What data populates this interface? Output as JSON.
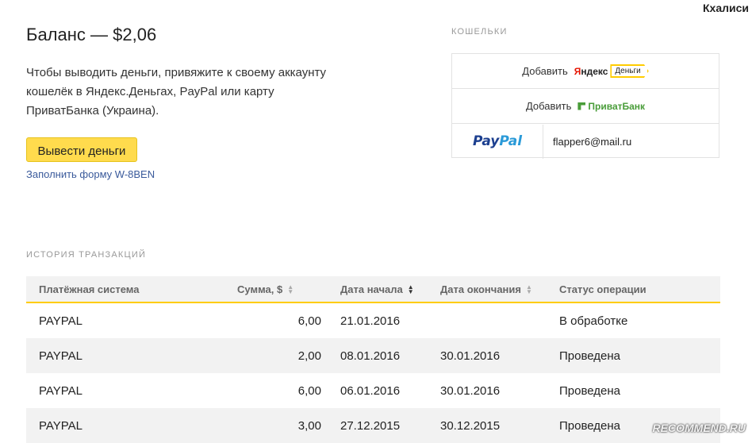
{
  "header": {
    "user_name": "Кхалиси"
  },
  "balance": {
    "title": "Баланс — $2,06"
  },
  "info": {
    "text": "Чтобы выводить деньги, привяжите к своему аккаунту кошелёк в Яндекс.Деньгах, PayPal или карту ПриватБанка (Украина)."
  },
  "actions": {
    "withdraw_label": "Вывести деньги",
    "w8_link": "Заполнить форму W-8BEN"
  },
  "wallets": {
    "section_label": "КОШЕЛЬКИ",
    "rows": [
      {
        "add_label": "Добавить",
        "logo_part1": "Яндекс",
        "logo_part2": "Деньги"
      },
      {
        "add_label": "Добавить",
        "logo_text": "ПриватБанк"
      },
      {
        "logo_pay": "Pay",
        "logo_pal": "Pal",
        "email": "flapper6@mail.ru"
      }
    ],
    "colors": {
      "yandex_red": "#e61400",
      "yandex_yellow": "#ffcc00",
      "privat_green": "#4a9d3a",
      "paypal_dark": "#1c3f8f",
      "paypal_light": "#2a9ad8"
    }
  },
  "transactions": {
    "section_label": "ИСТОРИЯ ТРАНЗАКЦИЙ",
    "columns": [
      "Платёжная система",
      "Сумма, $",
      "Дата начала",
      "Дата окончания",
      "Статус операции"
    ],
    "rows": [
      {
        "system": "PAYPAL",
        "amount": "6,00",
        "start": "21.01.2016",
        "end": "",
        "status": "В обработке"
      },
      {
        "system": "PAYPAL",
        "amount": "2,00",
        "start": "08.01.2016",
        "end": "30.01.2016",
        "status": "Проведена"
      },
      {
        "system": "PAYPAL",
        "amount": "6,00",
        "start": "06.01.2016",
        "end": "30.01.2016",
        "status": "Проведена"
      },
      {
        "system": "PAYPAL",
        "amount": "3,00",
        "start": "27.12.2015",
        "end": "30.12.2015",
        "status": "Проведена"
      }
    ]
  },
  "watermark": "RECOMMEND.RU",
  "theme": {
    "accent": "#ffdb4d",
    "link": "#3a5a9b"
  }
}
